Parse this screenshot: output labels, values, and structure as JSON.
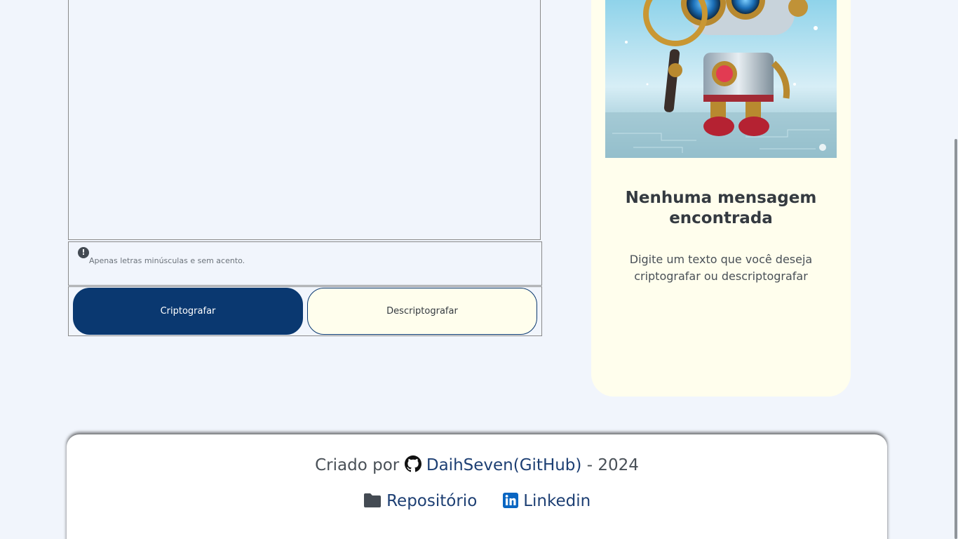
{
  "encrypt_form": {
    "textarea_value": "",
    "hint_text": "Apenas letras minúsculas e sem acento.",
    "hint_icon": "exclamation-circle-icon",
    "encrypt_label": "Criptografar",
    "decrypt_label": "Descriptografar"
  },
  "output": {
    "image": "robot-with-magnifying-glass",
    "title": "Nenhuma mensagem encontrada",
    "subtitle": "Digite um texto que você deseja criptografar ou descriptografar"
  },
  "footer": {
    "created_by": "Criado por",
    "github_user": "DaihSeven(GitHub)",
    "year_sep": "- 2024",
    "repo_label": "Repositório",
    "linkedin_label": "Linkedin"
  },
  "colors": {
    "background": "#f1f5fc",
    "primary": "#0a3870",
    "card": "#fffeed"
  }
}
